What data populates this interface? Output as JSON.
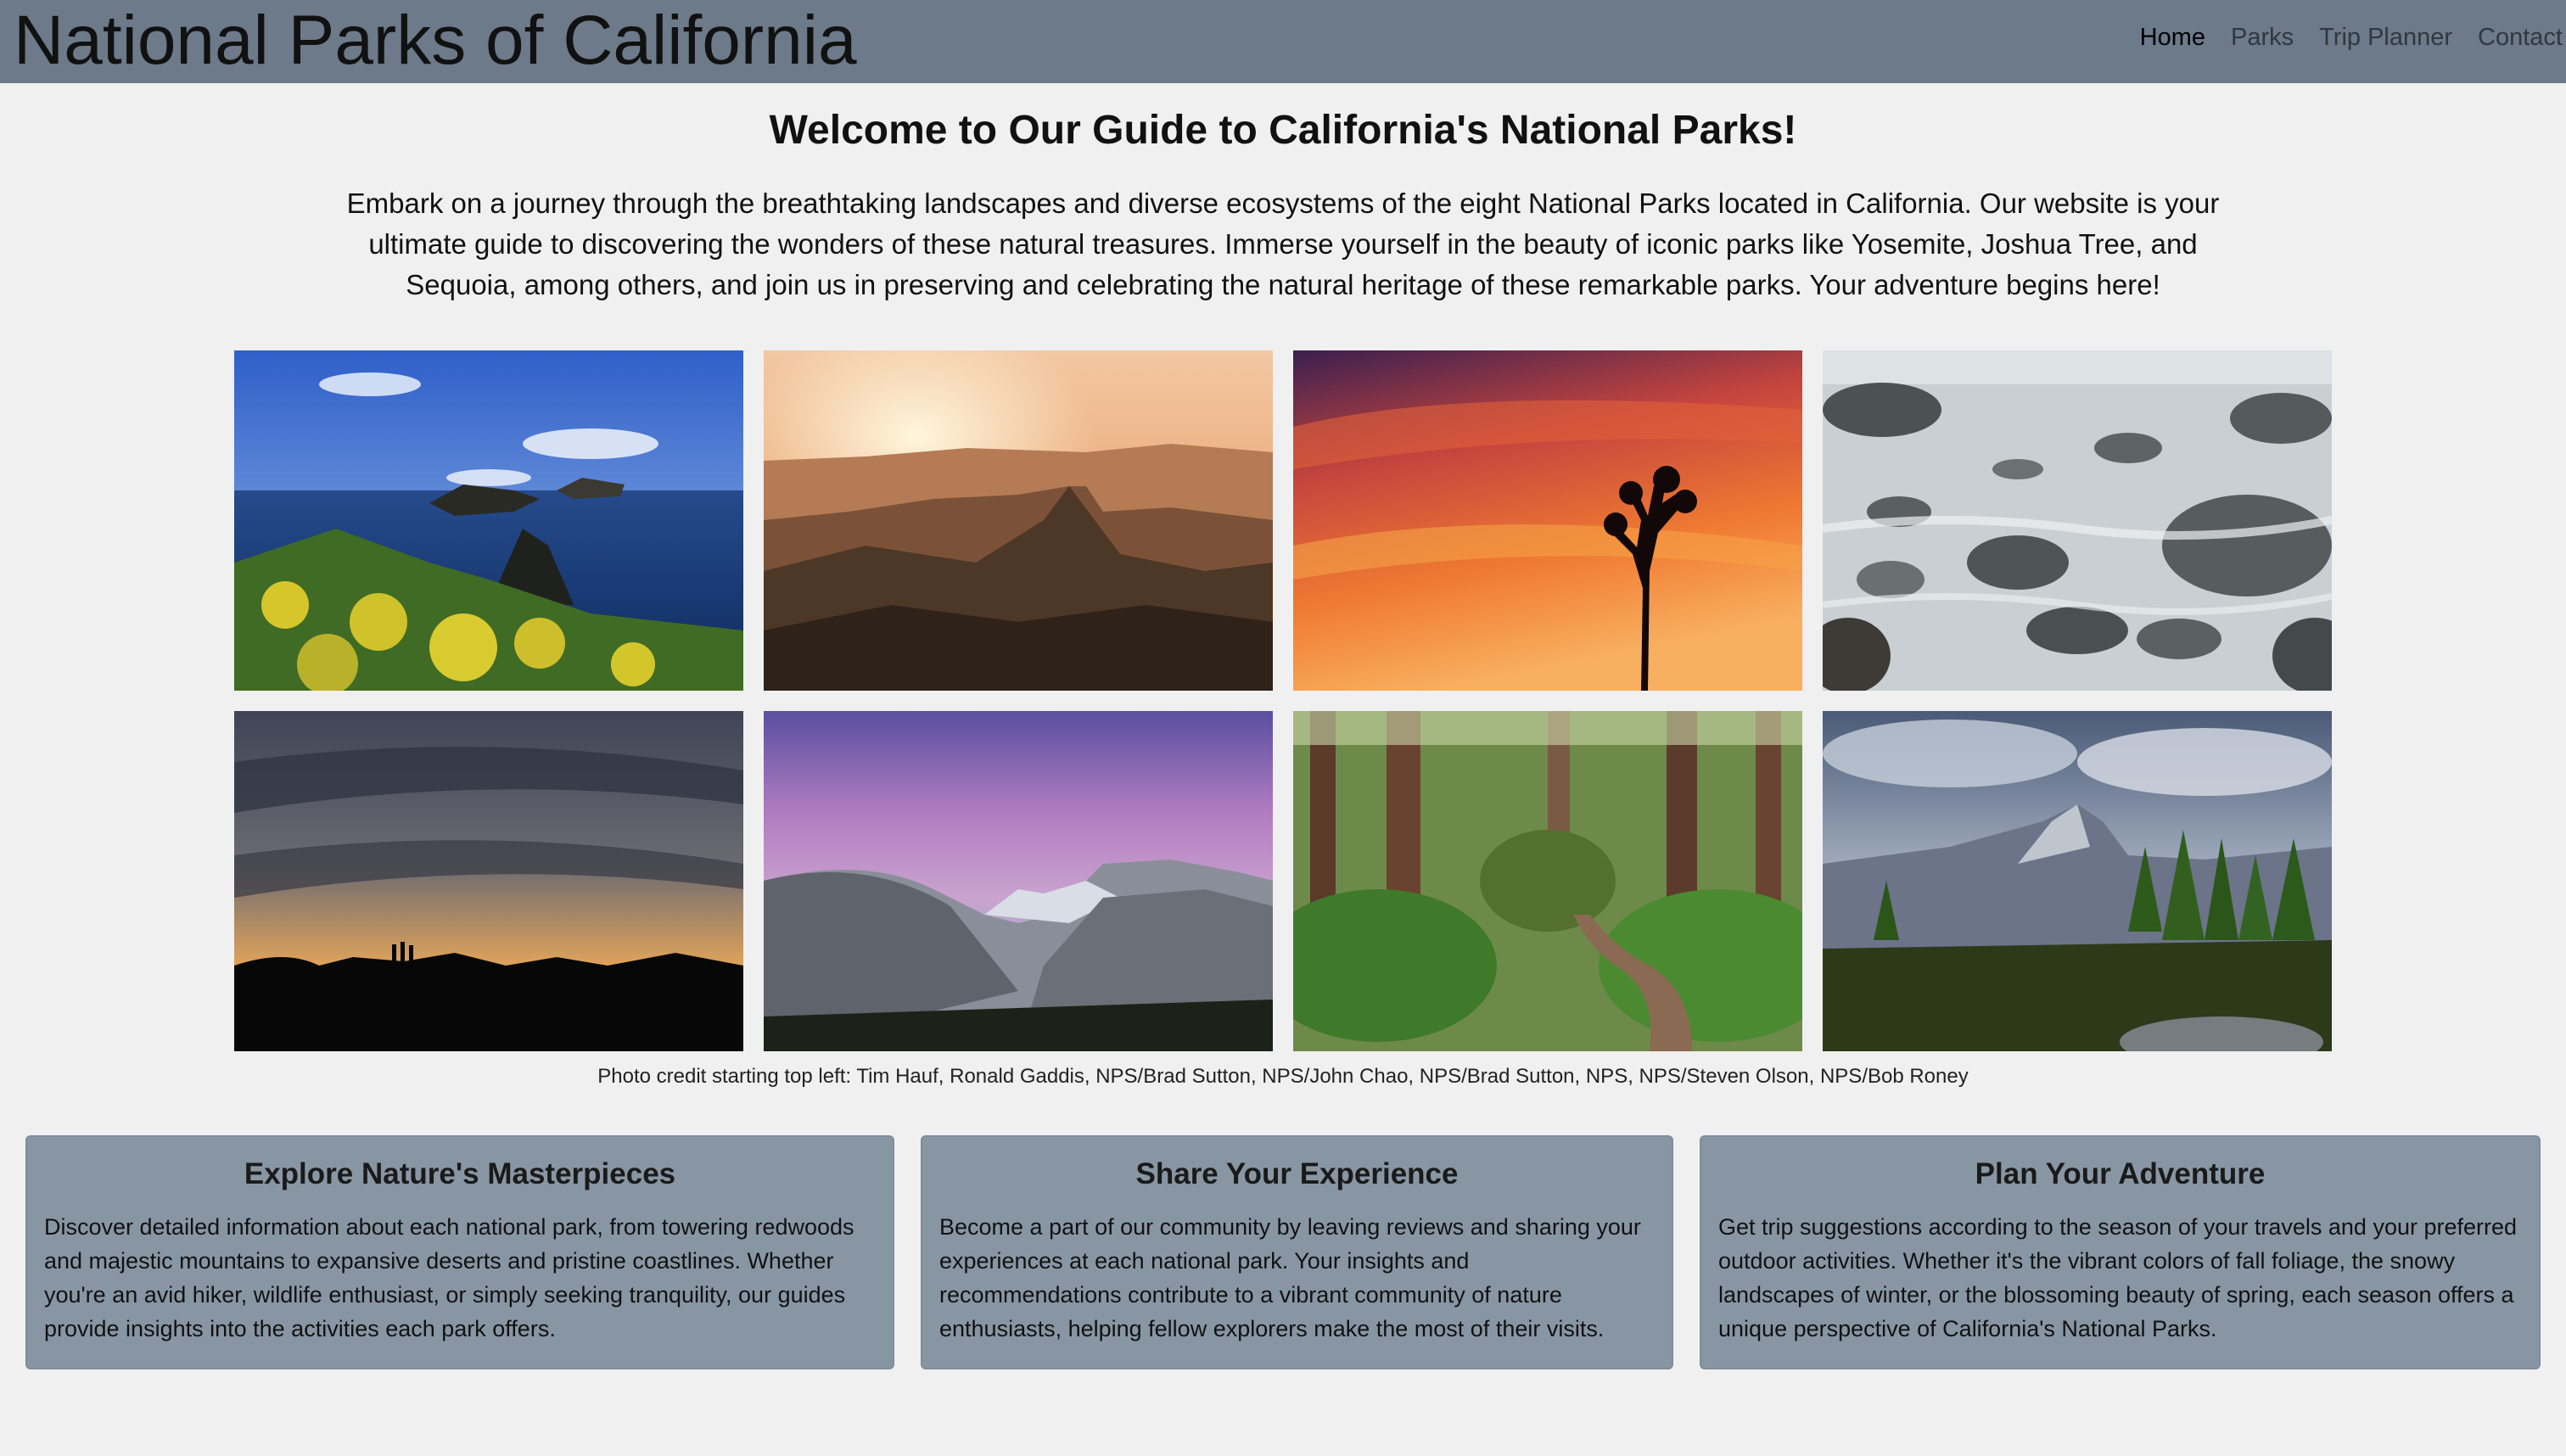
{
  "header": {
    "title": "National Parks of California",
    "nav": [
      "Home",
      "Parks",
      "Trip Planner",
      "Contact"
    ]
  },
  "main": {
    "welcome": "Welcome to Our Guide to California's National Parks!",
    "intro": "Embark on a journey through the breathtaking landscapes and diverse ecosystems of the eight National Parks located in California. Our website is your ultimate guide to discovering the wonders of these natural treasures. Immerse yourself in the beauty of iconic parks like Yosemite, Joshua Tree, and Sequoia, among others, and join us in preserving and celebrating the natural heritage of these remarkable parks. Your adventure begins here!",
    "credit": "Photo credit starting top left: Tim Hauf, Ronald Gaddis, NPS/Brad Sutton, NPS/John Chao, NPS/Brad Sutton, NPS, NPS/Steven Olson, NPS/Bob Roney"
  },
  "cards": [
    {
      "title": "Explore Nature's Masterpieces",
      "text": "Discover detailed information about each national park, from towering redwoods and majestic mountains to expansive deserts and pristine coastlines. Whether you're an avid hiker, wildlife enthusiast, or simply seeking tranquility, our guides provide insights into the activities each park offers."
    },
    {
      "title": "Share Your Experience",
      "text": "Become a part of our community by leaving reviews and sharing your experiences at each national park. Your insights and recommendations contribute to a vibrant community of nature enthusiasts, helping fellow explorers make the most of their visits."
    },
    {
      "title": "Plan Your Adventure",
      "text": "Get trip suggestions according to the season of your travels and your preferred outdoor activities. Whether it's the vibrant colors of fall foliage, the snowy landscapes of winter, or the blossoming beauty of spring, each season offers a unique perspective of California's National Parks."
    }
  ],
  "colors": {
    "header_bg": "#6c7a89",
    "card_bg": "#8896a4",
    "page_bg": "#f0f0f0"
  }
}
